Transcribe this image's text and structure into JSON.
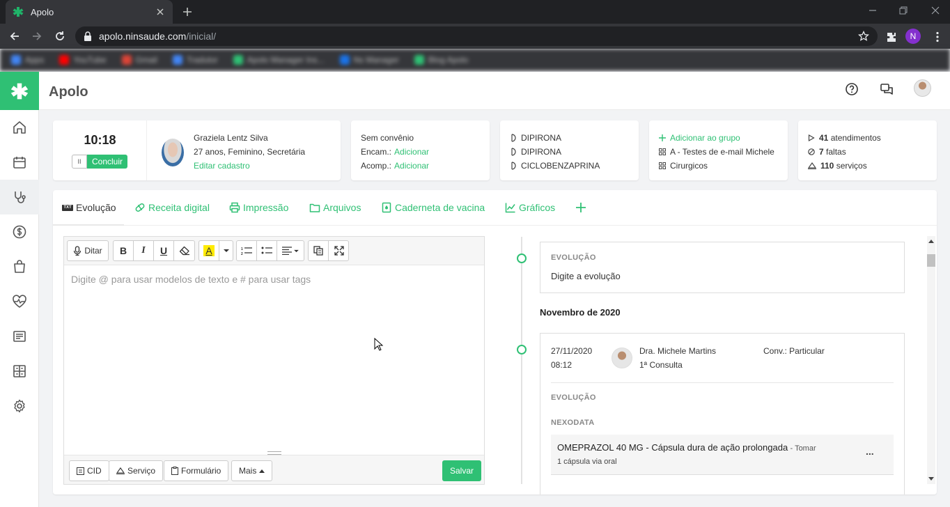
{
  "browser": {
    "tab_title": "Apolo",
    "url_host": "apolo.ninsaude.com",
    "url_path": "/inicial/",
    "profile_initial": "N",
    "bookmarks": [
      {
        "label": "Apps",
        "color": "#4285f4"
      },
      {
        "label": "YouTube",
        "color": "#ff0000"
      },
      {
        "label": "Gmail",
        "color": "#db4437"
      },
      {
        "label": "Tradutor",
        "color": "#4285f4"
      },
      {
        "label": "Apolo Manager Ins...",
        "color": "#2fc074"
      },
      {
        "label": "Ns Manager",
        "color": "#1a73e8"
      },
      {
        "label": "Blog Apolo",
        "color": "#2fc074"
      }
    ]
  },
  "app": {
    "title": "Apolo",
    "accent_color": "#2fc074",
    "sidebar_items": [
      "home-icon",
      "calendar-icon",
      "stethoscope-icon",
      "dollar-icon",
      "bag-icon",
      "heartbeat-icon",
      "report-icon",
      "grid-icon",
      "settings-icon"
    ]
  },
  "timer": {
    "time": "10:18",
    "pause": "II",
    "conclude_label": "Concluir"
  },
  "patient": {
    "name": "Graziela Lentz Silva",
    "details": "27 anos, Feminino, Secretária",
    "edit_link": "Editar cadastro"
  },
  "insurance": {
    "plan": "Sem convênio",
    "encam_label": "Encam.:",
    "encam_link": "Adicionar",
    "acomp_label": "Acomp.:",
    "acomp_link": "Adicionar"
  },
  "medications": [
    "DIPIRONA",
    "DIPIRONA",
    "CICLOBENZAPRINA"
  ],
  "groups": {
    "add_label": "Adicionar ao grupo",
    "items": [
      "A - Testes de e-mail Michele",
      "Cirurgicos"
    ]
  },
  "stats": [
    {
      "value": "41",
      "label": "atendimentos"
    },
    {
      "value": "7",
      "label": "faltas"
    },
    {
      "value": "110",
      "label": "serviços"
    }
  ],
  "tabs": [
    {
      "label": "Evolução"
    },
    {
      "label": "Receita digital"
    },
    {
      "label": "Impressão"
    },
    {
      "label": "Arquivos"
    },
    {
      "label": "Caderneta de vacina"
    },
    {
      "label": "Gráficos"
    }
  ],
  "editor": {
    "dictate_label": "Ditar",
    "placeholder": "Digite @ para usar modelos de texto e # para usar tags",
    "footer": {
      "cid": "CID",
      "servico": "Serviço",
      "formulario": "Formulário",
      "mais": "Mais",
      "save": "Salvar"
    }
  },
  "timeline": {
    "draft": {
      "heading": "EVOLUÇÃO",
      "text": "Digite a evolução"
    },
    "month": "Novembro de 2020",
    "entry": {
      "date": "27/11/2020",
      "time": "08:12",
      "doctor": "Dra. Michele Martins",
      "consult": "1ª Consulta",
      "conv": "Conv.: Particular",
      "section1": "EVOLUÇÃO",
      "section2": "NEXODATA",
      "drug": "OMEPRAZOL 40 MG - Cápsula dura de ação prolongada",
      "drug_action": "- Tomar",
      "dose": "1 cápsula via oral",
      "more": "..."
    }
  }
}
